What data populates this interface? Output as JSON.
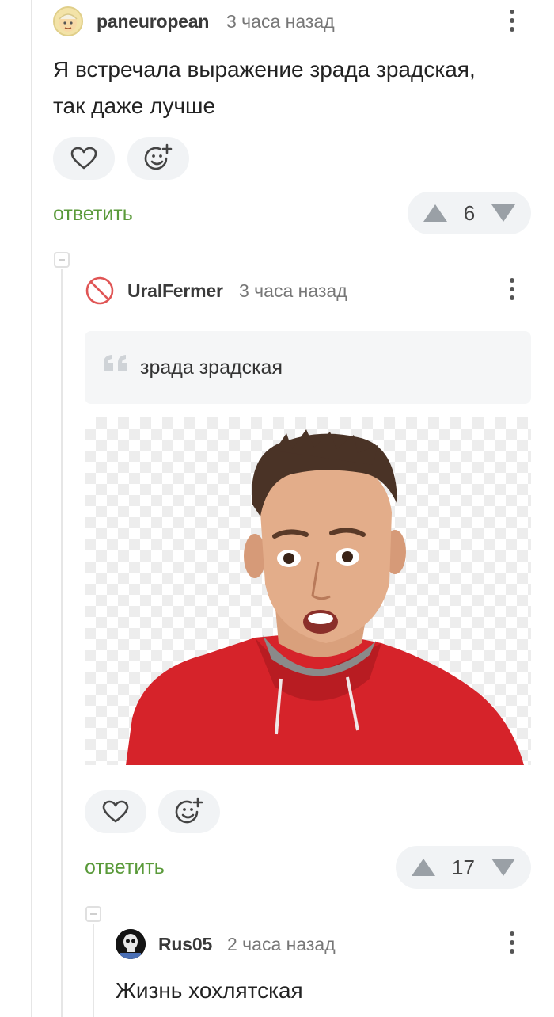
{
  "comments": [
    {
      "username": "paneuropean",
      "time": "3 часа назад",
      "text_lines": [
        "Я встречала выражение зрада зрадская,",
        "так даже лучше"
      ],
      "reply_label": "ответить",
      "votes": "6"
    },
    {
      "username": "UralFermer",
      "time": "3 часа назад",
      "quote": "зрада зрадская",
      "reply_label": "ответить",
      "votes": "17"
    },
    {
      "username": "Rus05",
      "time": "2 часа назад",
      "text": "Жизнь хохлятская"
    }
  ],
  "icons": {
    "like": "heart-icon",
    "reaction": "add-emoji-icon",
    "upvote": "triangle-up-icon",
    "downvote": "triangle-down-icon",
    "menu": "kebab-menu-icon",
    "collapse": "collapse-thread-icon"
  },
  "colors": {
    "reply_link": "#5a9a3a",
    "pill_bg": "#f1f3f5",
    "vote_arrow": "#9aa0a6"
  }
}
